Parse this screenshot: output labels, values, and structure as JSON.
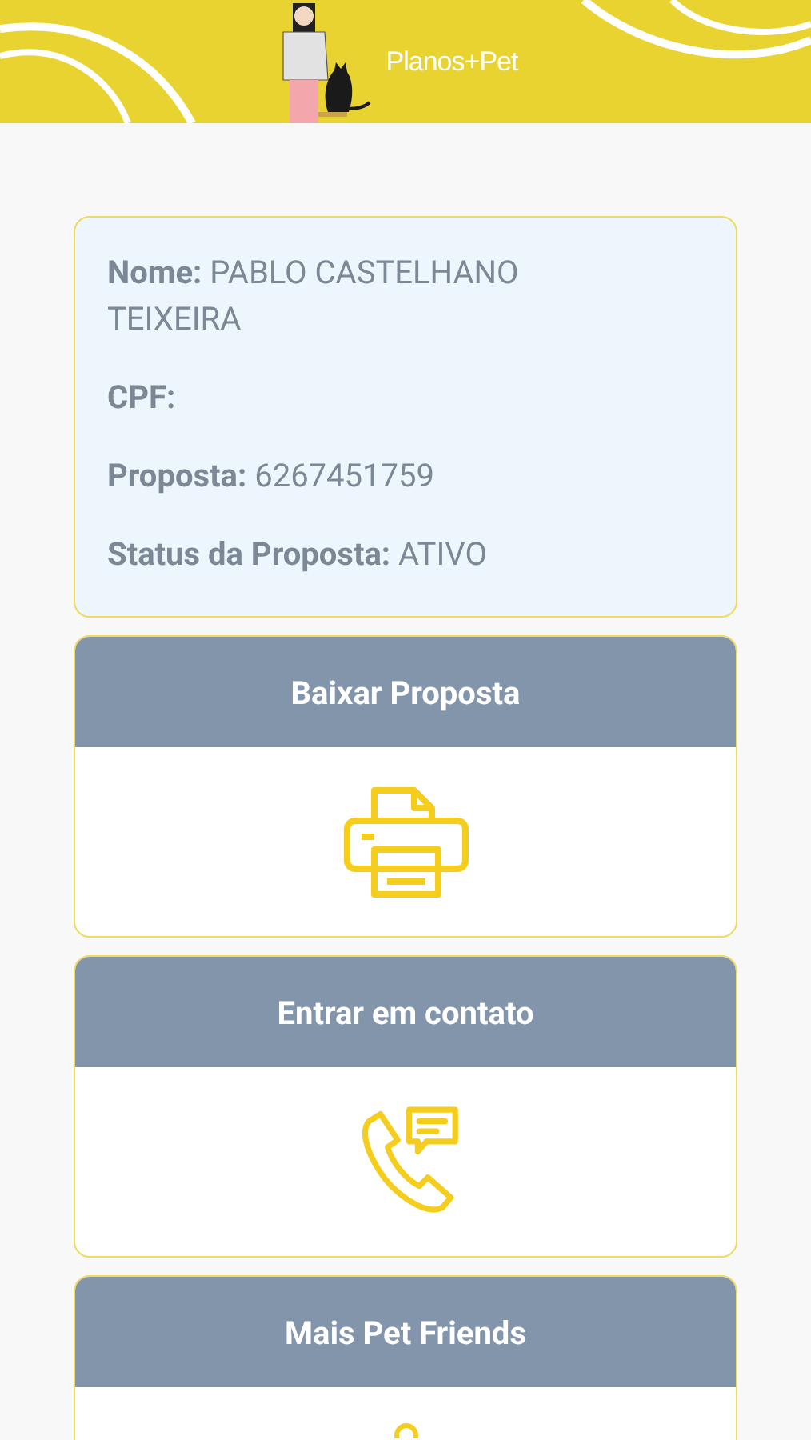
{
  "header": {
    "logo": "Planos+Pet"
  },
  "info": [
    {
      "label": "Nome:",
      "value": "PABLO CASTELHANO TEIXEIRA"
    },
    {
      "label": "CPF:"
    },
    {
      "label": "Proposta:",
      "value": "6267451759"
    },
    {
      "label": "Status da Proposta:",
      "value": "ATIVO"
    }
  ],
  "actions": [
    {
      "title": "Baixar Proposta",
      "kind": "printer"
    },
    {
      "title": "Entrar em contato",
      "kind": "phone"
    },
    {
      "title": "Mais Pet Friends",
      "kind": "partial"
    }
  ]
}
